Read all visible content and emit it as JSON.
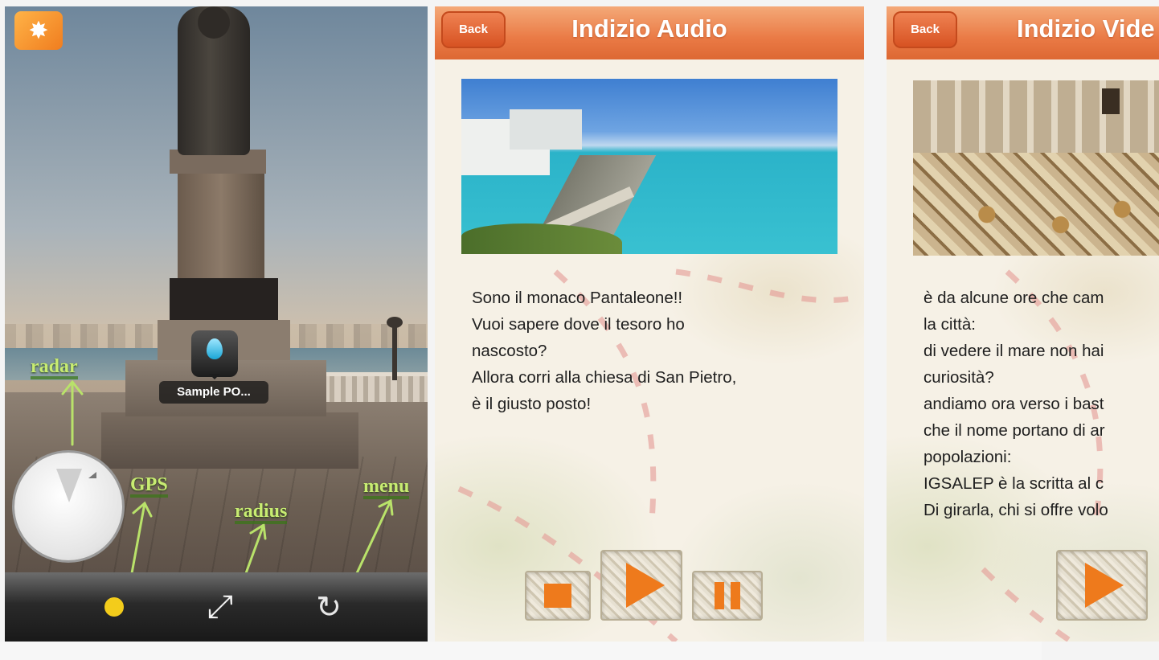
{
  "ar_view": {
    "poi_label": "Sample PO...",
    "annotations": {
      "radar": "radar",
      "gps": "GPS",
      "radius": "radius",
      "menu": "menu"
    },
    "toolbar": {
      "gps_icon": "gps-dot-icon",
      "radius_icon": "resize-arrows-icon",
      "menu_icon": "refresh-icon"
    },
    "colors": {
      "annotation": "#c8ec72",
      "gps_dot": "#f3cc1b"
    }
  },
  "audio_clue": {
    "back_label": "Back",
    "title": "Indizio Audio",
    "text": "Sono il monaco Pantaleone!!\nVuoi sapere dove il tesoro ho\nnascosto?\nAllora corri alla chiesa di San Pietro,\nè il giusto posto!",
    "controls": [
      "stop",
      "play",
      "pause"
    ],
    "colors": {
      "navbar": "#ea7a45",
      "controls": "#ee7a1c"
    }
  },
  "video_clue": {
    "back_label": "Back",
    "title": "Indizio Vide",
    "text": "è da alcune ore che cam\nla città:\ndi vedere il mare non hai\ncuriosità?\nandiamo ora verso i bast\nche il nome portano di ar\npopolazioni:\nIGSALEP è la scritta al c\nDi girarla, chi si offre volo",
    "controls": [
      "play"
    ]
  }
}
